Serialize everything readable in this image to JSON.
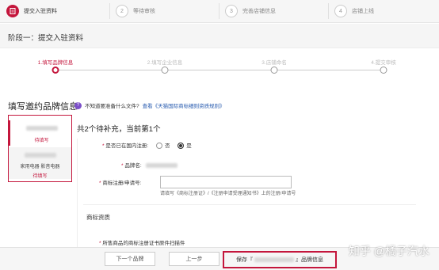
{
  "steps": [
    {
      "num": "1",
      "label": "提交入驻资料",
      "active": true
    },
    {
      "num": "2",
      "label": "等待审核",
      "active": false
    },
    {
      "num": "3",
      "label": "完善店铺信息",
      "active": false
    },
    {
      "num": "4",
      "label": "店铺上线",
      "active": false
    }
  ],
  "phase_title": "阶段一：提交入驻资料",
  "progress": [
    {
      "label": "1.填写品牌信息",
      "active": true
    },
    {
      "label": "2.填写企业信息",
      "active": false
    },
    {
      "label": "3.店铺命名",
      "active": false
    },
    {
      "label": "4.提交审核",
      "active": false
    }
  ],
  "heading": "填写邀约品牌信息",
  "help": {
    "q": "?",
    "text": "不知道要准备什么文件?",
    "link_prefix": "查看",
    "link": "《天猫国际商标细则资质规则》"
  },
  "brands": {
    "item1": {
      "status": "待填写"
    },
    "item2": {
      "category": "家用电器 影音电器",
      "status": "待填写"
    }
  },
  "form": {
    "count_text": "共2个待补充，当前第1个",
    "registered_label": "是否已在国内注册:",
    "no": "否",
    "yes": "是",
    "brand_name_label": "品牌名:",
    "trademark_label": "商标注册/申请号:",
    "hint": "请填写《商标注册证》/《注册申请受理通知书》上的注册/申请号"
  },
  "qualification": {
    "title": "商标资质",
    "req_star": "*",
    "item": "所售商品的商标注册证书原件扫描件"
  },
  "bottom": {
    "next_brand": "下一个品牌",
    "prev": "上一步",
    "save_prefix": "保存『",
    "save_suffix": "』品牌信息"
  },
  "watermark": "知乎 @橘子汽水"
}
